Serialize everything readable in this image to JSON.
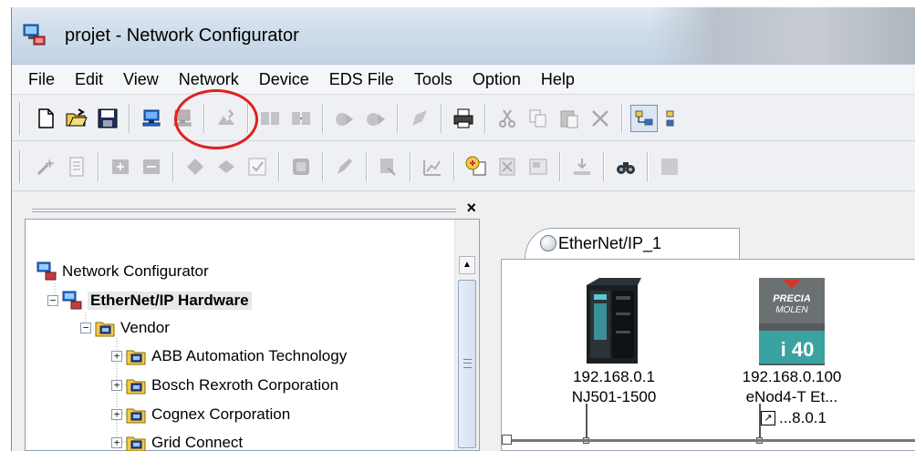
{
  "window": {
    "title": "projet - Network Configurator"
  },
  "menu": [
    "File",
    "Edit",
    "View",
    "Network",
    "Device",
    "EDS File",
    "Tools",
    "Option",
    "Help"
  ],
  "toolbar1": {
    "buttons": [
      "new-file-icon",
      "open-folder-icon",
      "save-icon",
      "connect-online-icon",
      "disconnect-icon",
      "upload-icon",
      "download-icon",
      "network-verify-icon",
      "network-compare-icon",
      "device-parameters-icon",
      "device-monitor-icon",
      "edit-icon",
      "print-icon",
      "cut-icon",
      "copy-icon",
      "paste-icon",
      "delete-icon",
      "view-toggle-icon",
      "view-list-icon"
    ],
    "highlighted": "connect-online-icon",
    "highlight_color": "#e02020"
  },
  "toolbar2": {
    "buttons": [
      "wizard-icon",
      "document-icon",
      "save-config-icon",
      "load-config-icon",
      "diamond-up-icon",
      "diamond-icon",
      "checkbox-icon",
      "book-icon",
      "pen-icon",
      "register-icon",
      "chart-icon",
      "install-eds-icon",
      "delete-eds-icon",
      "eds-property-icon",
      "eds-export-icon",
      "find-icon",
      "more-icon"
    ]
  },
  "left_panel": {
    "tree": [
      {
        "label": "Network Configurator",
        "level": 0,
        "icon": "network-computer-icon",
        "expander": ""
      },
      {
        "label": "EtherNet/IP Hardware",
        "level": 1,
        "icon": "network-computer-icon",
        "expander": "−",
        "bold": true
      },
      {
        "label": "Vendor",
        "level": 2,
        "icon": "folder-device-icon",
        "expander": "−"
      },
      {
        "label": "ABB Automation Technology",
        "level": 3,
        "icon": "folder-device-icon",
        "expander": "+"
      },
      {
        "label": "Bosch Rexroth Corporation",
        "level": 3,
        "icon": "folder-device-icon",
        "expander": "+"
      },
      {
        "label": "Cognex Corporation",
        "level": 3,
        "icon": "folder-device-icon",
        "expander": "+"
      },
      {
        "label": "Grid Connect",
        "level": 3,
        "icon": "folder-device-icon",
        "expander": "+"
      }
    ],
    "close_glyph": "×"
  },
  "right_panel": {
    "tab": "EtherNet/IP_1",
    "devices": [
      {
        "ip": "192.168.0.1",
        "name": "NJ501-1500",
        "icon": "omron-plc-icon"
      },
      {
        "ip": "192.168.0.100",
        "name": "eNod4-T Et...",
        "icon": "precia-molen-i40-icon",
        "brand": "PRECIA MOLEN",
        "model": "i 40",
        "link_label": "...8.0.1"
      }
    ]
  }
}
